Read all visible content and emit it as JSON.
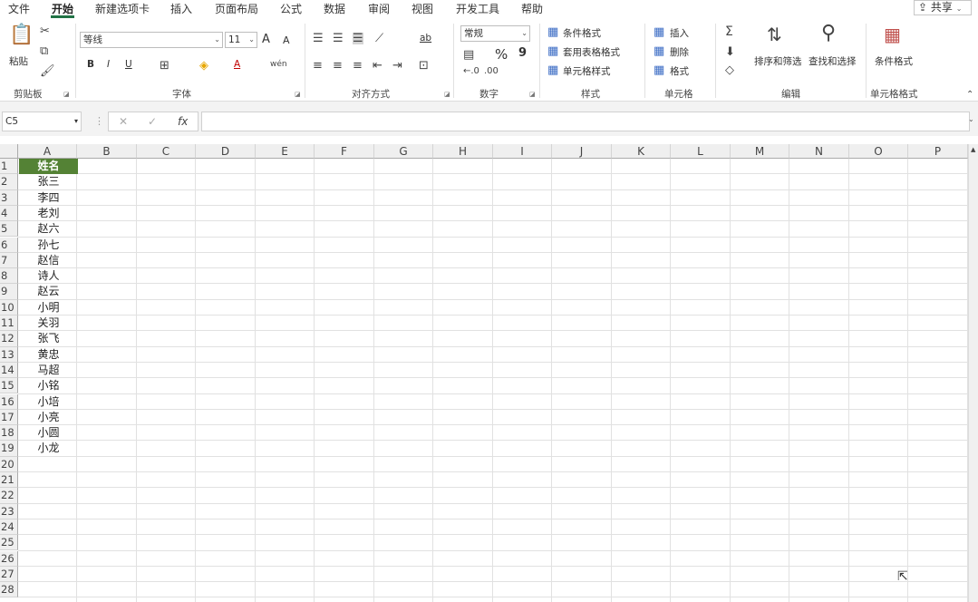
{
  "menu": {
    "tabs": [
      "文件",
      "开始",
      "新建选项卡",
      "插入",
      "页面布局",
      "公式",
      "数据",
      "审阅",
      "视图",
      "开发工具",
      "帮助"
    ],
    "active_tab": "开始",
    "share_label": "共享"
  },
  "ribbon": {
    "clipboard": {
      "paste_label": "粘贴",
      "group_label": "剪贴板"
    },
    "font": {
      "font_name": "等线",
      "font_size": "11",
      "group_label": "字体",
      "bold": "B",
      "italic": "I",
      "underline": "U",
      "grow": "A",
      "shrink": "A",
      "font_color_letter": "A"
    },
    "alignment": {
      "group_label": "对齐方式",
      "wrap": "ab"
    },
    "number": {
      "format": "常规",
      "percent": "%",
      "comma": "9",
      "group_label": "数字"
    },
    "styles": {
      "conditional": "条件格式",
      "table_format": "套用表格格式",
      "cell_styles": "单元格样式",
      "group_label": "样式"
    },
    "cells": {
      "insert": "插入",
      "delete": "删除",
      "format": "格式",
      "group_label": "单元格"
    },
    "editing": {
      "sort_filter": "排序和筛选",
      "find_select": "查找和选择",
      "group_label": "编辑"
    },
    "extra": {
      "conditional_format": "条件格式",
      "group_label": "单元格格式"
    }
  },
  "formula_bar": {
    "name_box": "C5",
    "fx": "fx",
    "formula": ""
  },
  "sheet": {
    "columns": [
      "A",
      "B",
      "C",
      "D",
      "E",
      "F",
      "G",
      "H",
      "I",
      "J",
      "K",
      "L",
      "M",
      "N",
      "O",
      "P"
    ],
    "row_numbers": [
      "1",
      "2",
      "3",
      "4",
      "5",
      "6",
      "7",
      "8",
      "9",
      "10",
      "11",
      "12",
      "13",
      "14",
      "15",
      "16",
      "17",
      "18",
      "19",
      "20",
      "21",
      "22",
      "23",
      "24",
      "25",
      "26",
      "27",
      "28"
    ],
    "header_cell": "姓名",
    "names": [
      "张三",
      "李四",
      "老刘",
      "赵六",
      "孙七",
      "赵信",
      "诗人",
      "赵云",
      "小明",
      "关羽",
      "张飞",
      "黄忠",
      "马超",
      "小铭",
      "小培",
      "小亮",
      "小圆",
      "小龙"
    ],
    "header_fill": "#548235",
    "accent": "#217346"
  }
}
